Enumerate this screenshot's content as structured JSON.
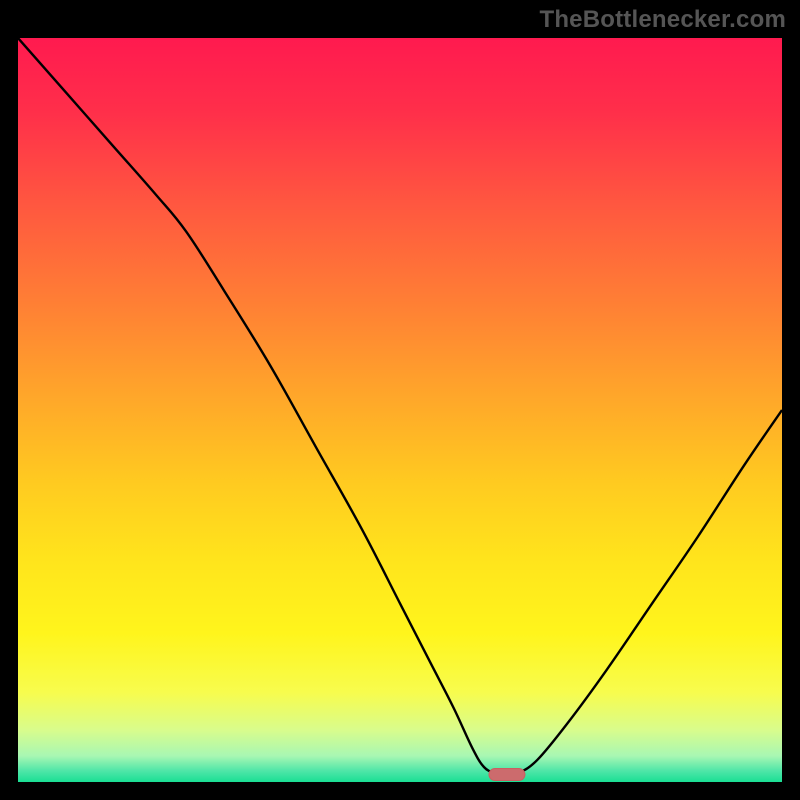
{
  "watermark": "TheBottlenecker.com",
  "colors": {
    "frame": "#000000",
    "watermark": "#555555",
    "curve": "#000000",
    "marker_fill": "#cc6b6d",
    "marker_stroke": "#c95f61",
    "gradient_stops": [
      {
        "offset": 0.0,
        "color": "#ff1a4f"
      },
      {
        "offset": 0.1,
        "color": "#ff2f4a"
      },
      {
        "offset": 0.22,
        "color": "#ff5640"
      },
      {
        "offset": 0.35,
        "color": "#ff7d35"
      },
      {
        "offset": 0.48,
        "color": "#ffa62a"
      },
      {
        "offset": 0.6,
        "color": "#ffcb20"
      },
      {
        "offset": 0.7,
        "color": "#ffe41c"
      },
      {
        "offset": 0.8,
        "color": "#fff51c"
      },
      {
        "offset": 0.88,
        "color": "#f7fc4e"
      },
      {
        "offset": 0.93,
        "color": "#d9fc8c"
      },
      {
        "offset": 0.965,
        "color": "#a8f7b3"
      },
      {
        "offset": 0.985,
        "color": "#4fe6a8"
      },
      {
        "offset": 1.0,
        "color": "#1adf94"
      }
    ]
  },
  "chart_data": {
    "type": "line",
    "title": "",
    "xlabel": "",
    "ylabel": "",
    "xlim": [
      0,
      100
    ],
    "ylim": [
      0,
      100
    ],
    "grid": false,
    "legend": null,
    "series": [
      {
        "name": "bottleneck-curve",
        "x": [
          0,
          6,
          12,
          18,
          22,
          27,
          33,
          39,
          45,
          50,
          54,
          57,
          59.5,
          61,
          62.5,
          64,
          65.5,
          68,
          72,
          77,
          83,
          89,
          95,
          100
        ],
        "values": [
          100,
          93,
          86,
          79,
          74,
          66,
          56,
          45,
          34,
          24,
          16,
          10,
          4.5,
          2,
          1.2,
          1.0,
          1.2,
          3,
          8,
          15,
          24,
          33,
          42.5,
          50
        ]
      }
    ],
    "marker": {
      "x": 64,
      "y": 1.0,
      "shape": "pill"
    },
    "annotations": []
  }
}
